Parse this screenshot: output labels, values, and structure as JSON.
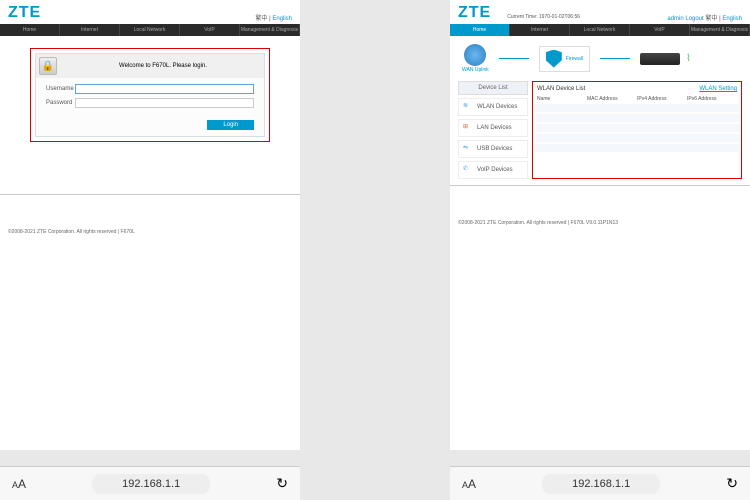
{
  "brand": "ZTE",
  "left": {
    "lang_sep": "繁中 |",
    "lang": "English",
    "nav": [
      "Home",
      "Internet",
      "Local Network",
      "VoIP",
      "Management & Diagnosis"
    ],
    "login_title": "Welcome to F670L. Please login.",
    "username_label": "Username",
    "password_label": "Password",
    "login_btn": "Login",
    "footer": "©2008-2021 ZTE Corporation. All rights reserved  |  F670L"
  },
  "right": {
    "current_time_label": "Current Time: 1970-01-02T06:56",
    "links": {
      "admin": "admin",
      "logout": "Logout",
      "sep": "繁中 |",
      "lang": "English"
    },
    "nav": [
      "Home",
      "Internet",
      "Local Network",
      "VoIP",
      "Management & Diagnosis"
    ],
    "topo": {
      "wan": "WAN Uplink",
      "firewall": "Firewall"
    },
    "sidebar_head": "Device List",
    "sidebar": [
      "WLAN Devices",
      "LAN Devices",
      "USB Devices",
      "VoIP Devices"
    ],
    "panel_title": "WLAN Device List",
    "panel_link": "WLAN Setting",
    "cols": [
      "Name",
      "MAC Address",
      "IPv4 Address",
      "IPv6 Address"
    ],
    "footer": "©2008-2021 ZTE Corporation. All rights reserved  |  F670L V9.0.11P1N13"
  },
  "toolbar": {
    "address": "192.168.1.1"
  }
}
